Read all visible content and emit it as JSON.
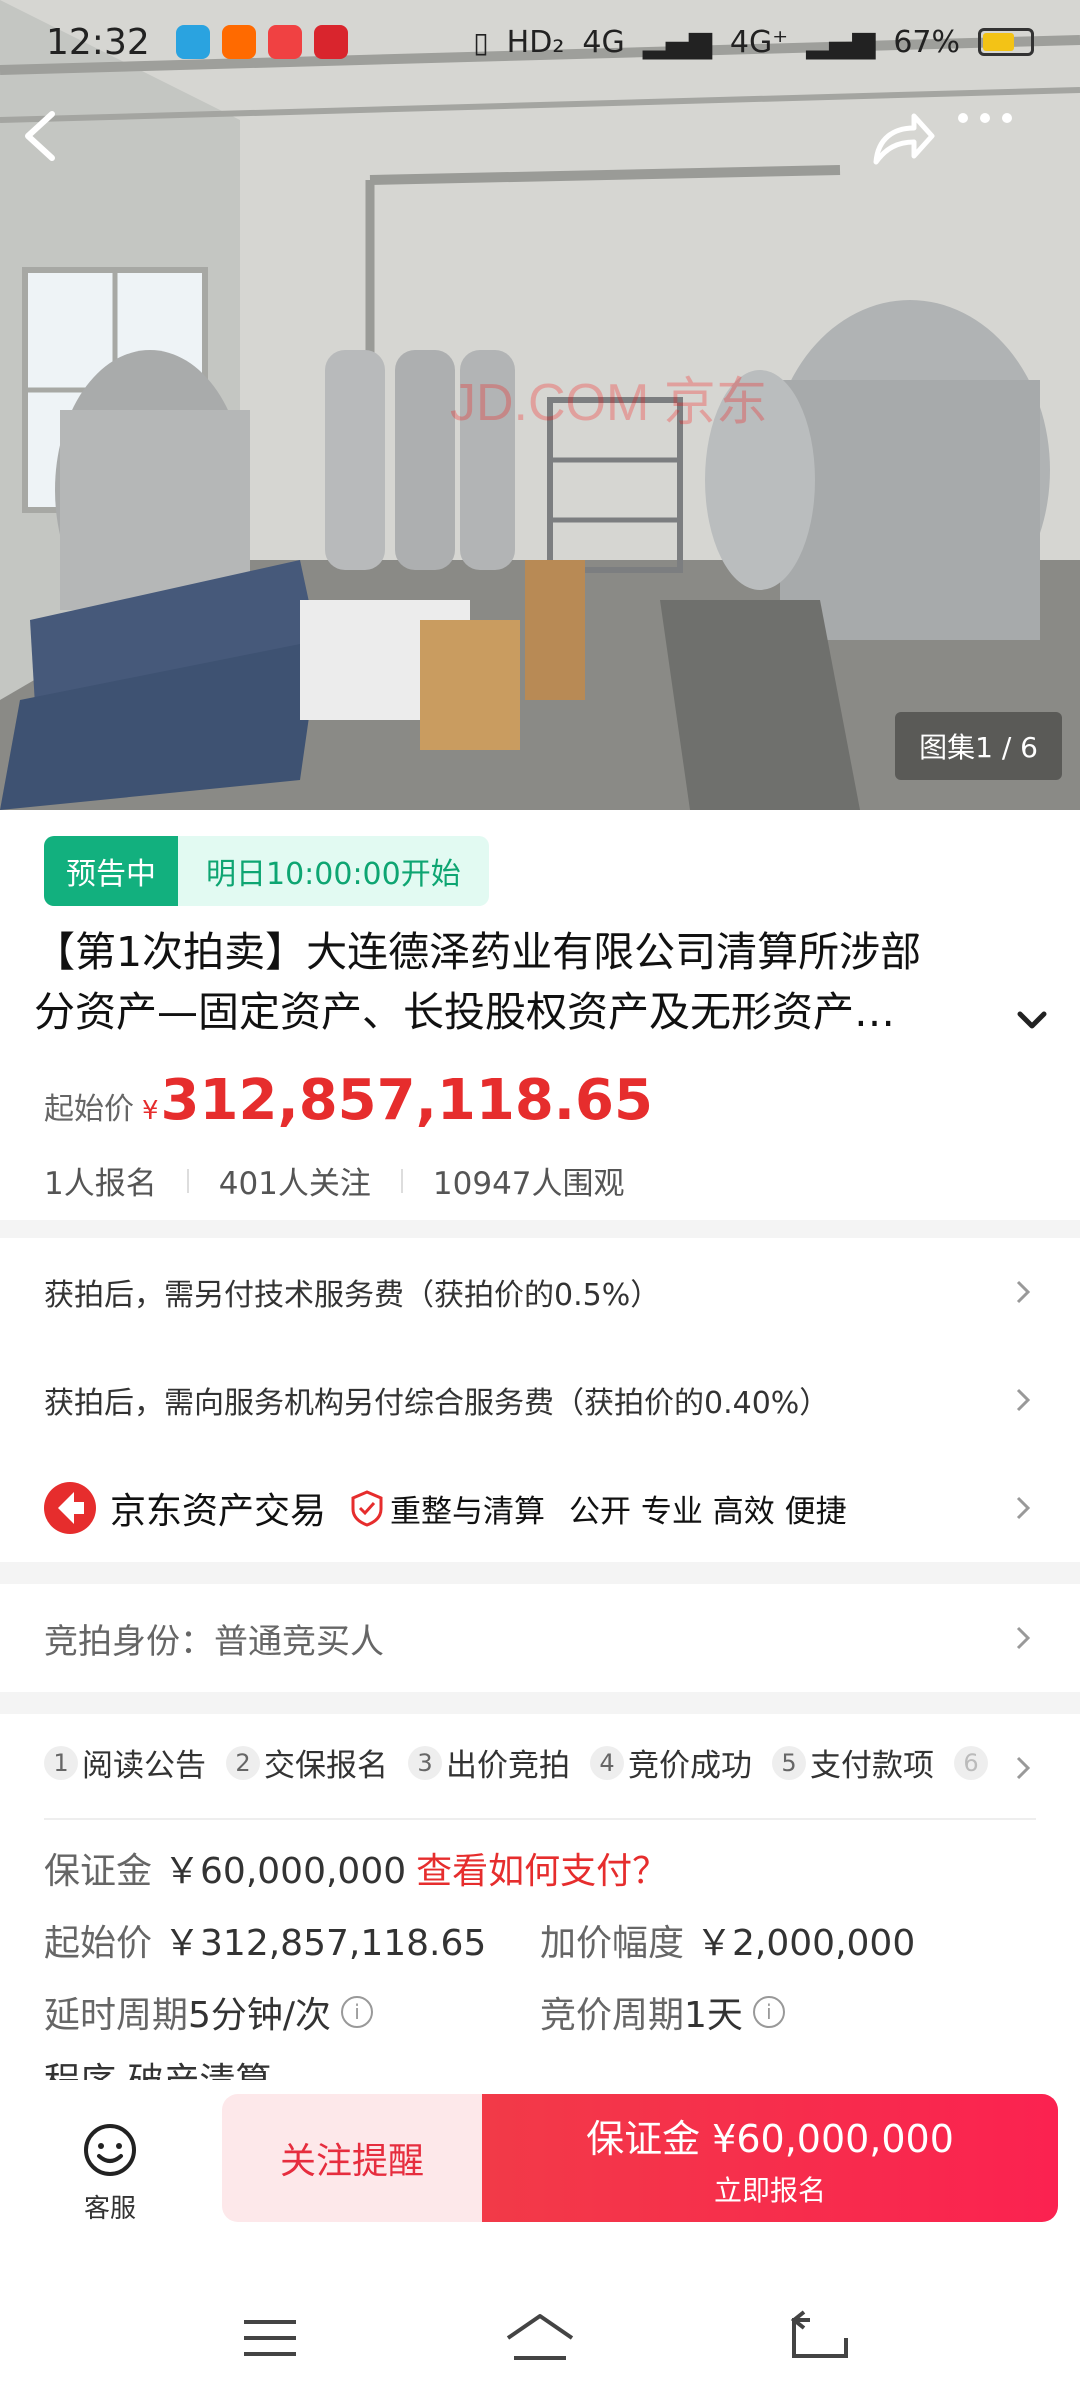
{
  "status_bar": {
    "time": "12:32",
    "hd": "HD₂",
    "net1": "4G",
    "net2": "4G⁺",
    "battery": "67%",
    "battery_level": 0.67
  },
  "hero": {
    "watermark": "JD.COM 京东",
    "gallery_counter": "图集1 / 6"
  },
  "auction": {
    "status_tag": "预告中",
    "start_time": "明日10:00:00开始",
    "title_line1": "【第1次拍卖】大连德泽药业有限公司清算所涉部",
    "title_line2": "分资产—固定资产、长投股权资产及无形资产…",
    "price_label": "起始价",
    "price_currency": "¥",
    "price": "312,857,118.65",
    "stats": [
      "1人报名",
      "401人关注",
      "10947人围观"
    ]
  },
  "notices": {
    "tech_fee": "获拍后，需另付技术服务费（获拍价的0.5%）",
    "service_fee": "获拍后，需向服务机构另付综合服务费（获拍价的0.40%）"
  },
  "platform": {
    "name": "京东资产交易",
    "cert": "重整与清算",
    "slogan": "公开 专业 高效 便捷"
  },
  "identity": "竞拍身份：普通竞买人",
  "steps": [
    {
      "num": "1",
      "label": "阅读公告"
    },
    {
      "num": "2",
      "label": "交保报名"
    },
    {
      "num": "3",
      "label": "出价竞拍"
    },
    {
      "num": "4",
      "label": "竞价成功"
    },
    {
      "num": "5",
      "label": "支付款项"
    },
    {
      "num": "6",
      "label": ""
    }
  ],
  "details": {
    "deposit_label": "保证金",
    "deposit_value": "￥60,000,000",
    "deposit_link": "查看如何支付？",
    "start_label": "起始价",
    "start_value": "￥312,857,118.65",
    "increment_label": "加价幅度",
    "increment_value": "￥2,000,000",
    "extend_label": "延时周期",
    "extend_value": "5分钟/次",
    "cycle_label": "竞价周期",
    "cycle_value": "1天",
    "procedure_partial": "程序 破产清算"
  },
  "bottom": {
    "service_label": "客服",
    "follow_label": "关注提醒",
    "signup_main": "保证金 ¥60,000,000",
    "signup_sub": "立即报名"
  },
  "colors": {
    "accent_red": "#e62d2d",
    "status_green": "#12b07e"
  }
}
